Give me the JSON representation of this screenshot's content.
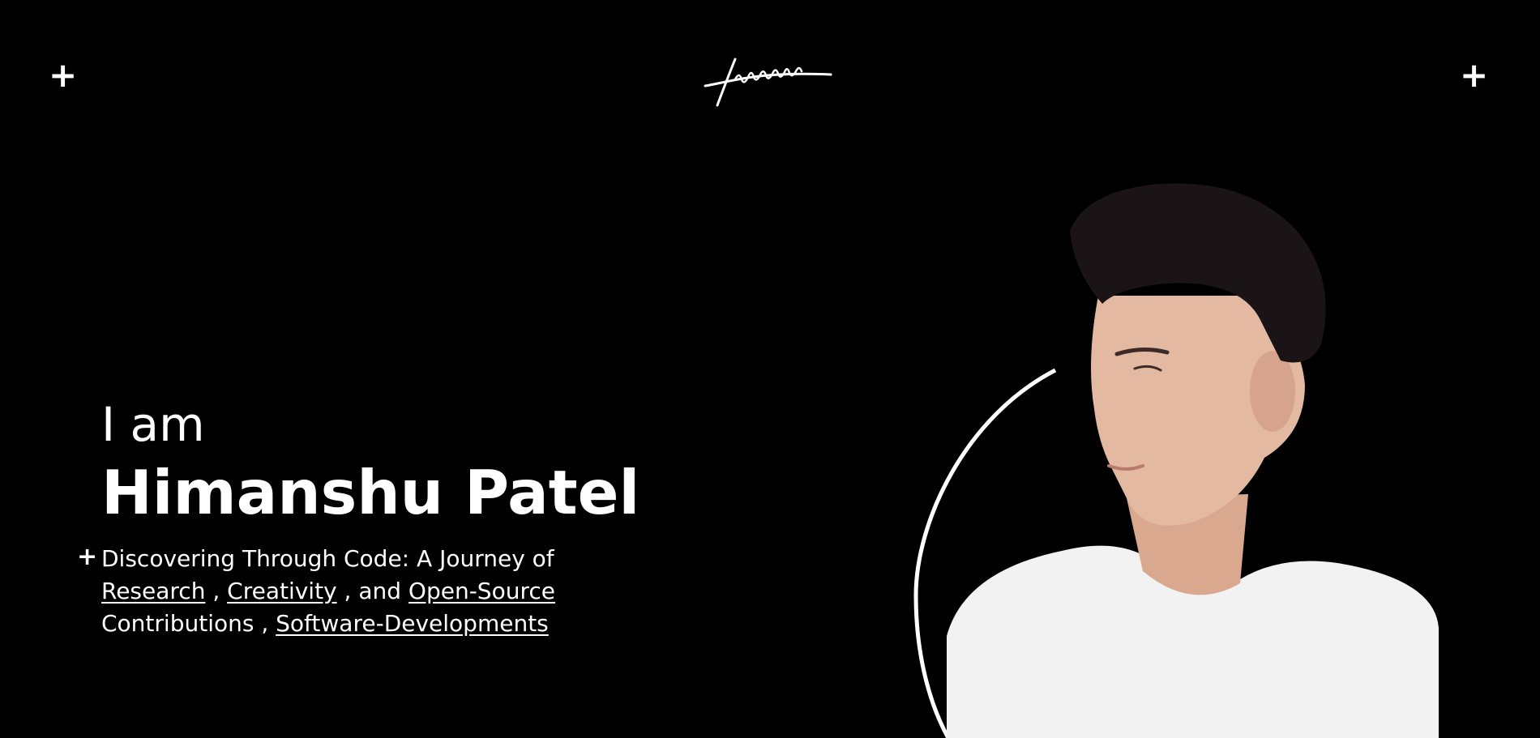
{
  "header": {
    "logo_text": "Himanshu",
    "left_plus": "+",
    "right_plus": "+"
  },
  "hero": {
    "intro": "I am",
    "name": "Himanshu Patel",
    "tagline_plus": "+",
    "tagline": {
      "lead": "Discovering Through Code: A Journey of",
      "link_research": "Research",
      "sep1": " , ",
      "link_creativity": "Creativity",
      "sep2": " , and ",
      "link_open_source": "Open-Source",
      "mid": "Contributions",
      "sep3": " , ",
      "link_software": "Software-Developments"
    }
  },
  "colors": {
    "background": "#000000",
    "text": "#ffffff",
    "shirt": "#f2f2f2",
    "skin": "#e3b9a1",
    "hair": "#1a1416"
  }
}
